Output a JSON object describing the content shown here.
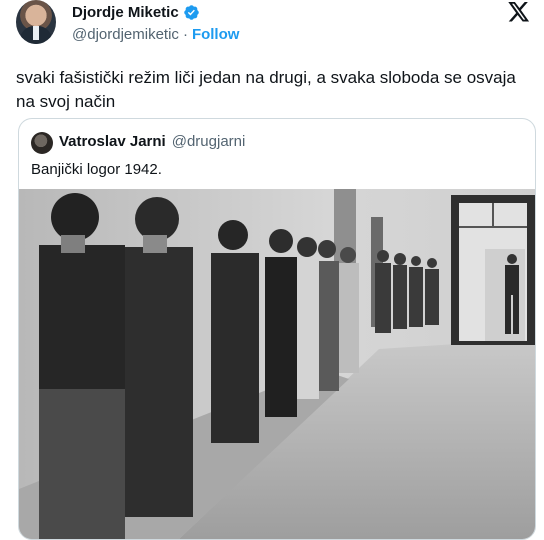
{
  "author": {
    "name": "Djordje Miketic",
    "handle": "@djordjemiketic",
    "separator": "·",
    "follow_label": "Follow"
  },
  "tweet": {
    "text": "svaki fašistički režim liči jedan na drugi, a svaka sloboda se osvaja na svoj način"
  },
  "quoted_tweet": {
    "name": "Vatroslav Jarni",
    "handle": "@drugjarni",
    "text": "Banjički logor 1942."
  },
  "colors": {
    "follow": "#1d9bf0",
    "verified": "#1d9bf0",
    "muted_text": "#536471",
    "border": "#cfd9de"
  },
  "icons": [
    "verified-badge-icon",
    "x-logo-icon"
  ]
}
